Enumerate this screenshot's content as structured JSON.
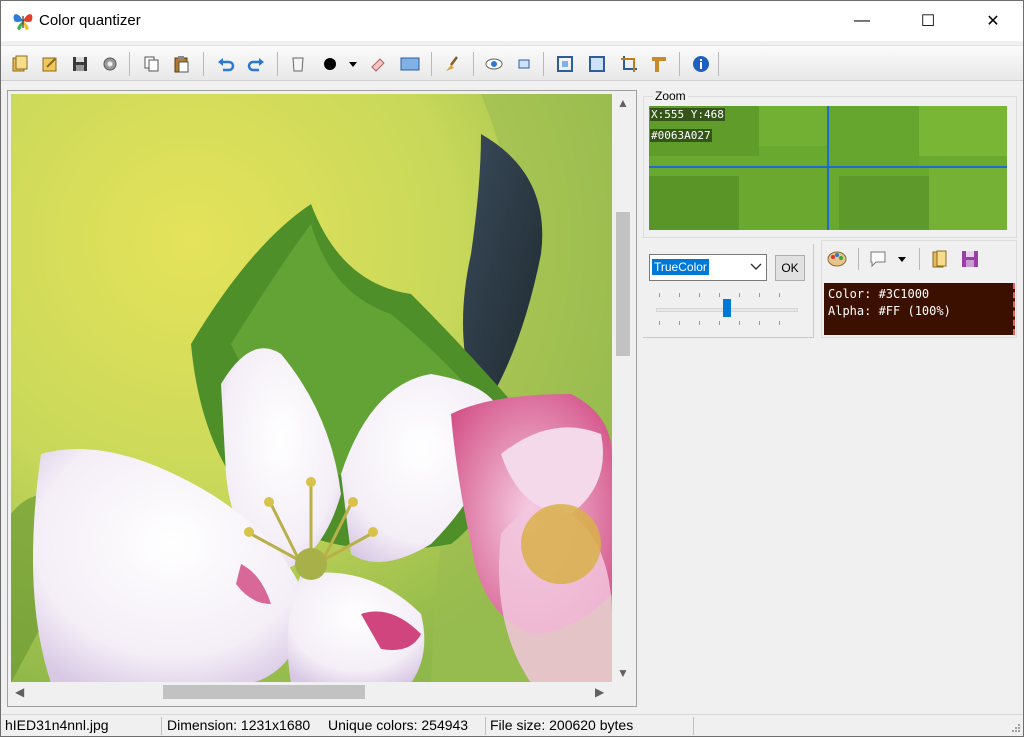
{
  "window": {
    "title": "Color quantizer",
    "controls": {
      "minimize": "—",
      "maximize": "☐",
      "close": "✕"
    }
  },
  "toolbar": {
    "buttons": [
      {
        "name": "open-icon"
      },
      {
        "name": "open-recent-icon"
      },
      {
        "name": "save-icon"
      },
      {
        "name": "settings-icon"
      },
      {
        "name": "copy-icon"
      },
      {
        "name": "paste-icon"
      },
      {
        "name": "undo-icon"
      },
      {
        "name": "redo-icon"
      },
      {
        "name": "mask-icon"
      },
      {
        "name": "brush-size-icon"
      },
      {
        "name": "eraser-icon"
      },
      {
        "name": "rectangle-icon"
      },
      {
        "name": "clear-brush-icon"
      },
      {
        "name": "preview-icon"
      },
      {
        "name": "small-view-icon"
      },
      {
        "name": "fit-icon"
      },
      {
        "name": "full-view-icon"
      },
      {
        "name": "crop-icon"
      },
      {
        "name": "resize-icon"
      },
      {
        "name": "info-icon"
      }
    ]
  },
  "zoom": {
    "label": "Zoom",
    "coords": "X:555 Y:468",
    "hex": "#0063A027"
  },
  "palette": {
    "mode_selected": "TrueColor",
    "ok_label": "OK",
    "slider_level": 0.5
  },
  "color_panel": {
    "color_line": "Color: #3C1000",
    "alpha_line": "Alpha: #FF (100%)",
    "swatch_color": "#3C1000"
  },
  "status": {
    "filename": "hIED31n4nnl.jpg",
    "dimension": "Dimension: 1231x1680",
    "unique_colors": "Unique colors: 254943",
    "file_size": "File size: 200620 bytes"
  },
  "colors": {
    "accent": "#0078D7",
    "zoom_green": "#6AA92F"
  }
}
